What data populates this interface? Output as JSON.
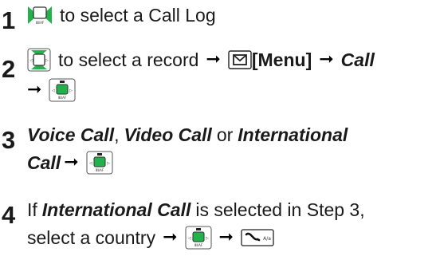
{
  "steps": [
    {
      "number": "1",
      "key_icon": "nav-key-left-right-icon",
      "text": "to select a Call Log"
    },
    {
      "number": "2",
      "key_icon": "nav-key-up-down-icon",
      "text_a": "to select a record",
      "menu_key_icon": "mail-key-icon",
      "menu_label": "[Menu]",
      "call_label": "Call",
      "confirm_key_icon": "center-key-icon"
    },
    {
      "number": "3",
      "option1": "Voice Call",
      "sep1": ",",
      "option2": "Video Call",
      "or_text": "or",
      "option3a": "International",
      "option3b": "Call",
      "confirm_key_icon": "center-key-icon"
    },
    {
      "number": "4",
      "text_a": "If",
      "option": "International Call",
      "text_b": "is selected in Step 3,",
      "text_c": "select a country",
      "confirm_key_icon": "center-key-icon",
      "call_key_icon": "call-key-icon",
      "call_key_label": "A/a"
    }
  ],
  "key_small_label": "ⅢI/AF"
}
